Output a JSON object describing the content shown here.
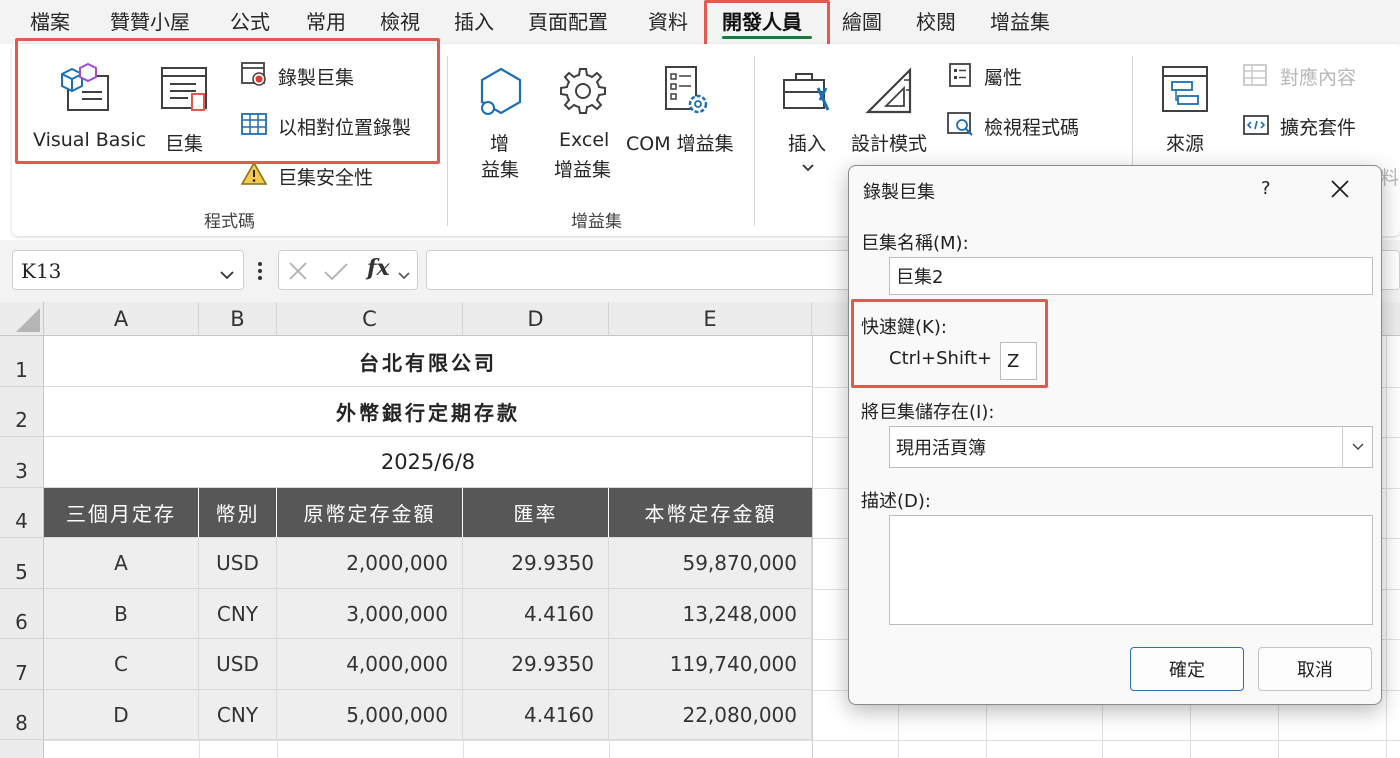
{
  "menu": {
    "tabs": [
      "檔案",
      "贊贊小屋",
      "公式",
      "常用",
      "檢視",
      "插入",
      "頁面配置",
      "資料",
      "開發人員",
      "繪圖",
      "校閱",
      "增益集"
    ],
    "active_tab": "開發人員"
  },
  "ribbon": {
    "code_group": {
      "label": "程式碼",
      "visual_basic": "Visual Basic",
      "macros": "巨集",
      "record_macro": "錄製巨集",
      "relative_ref": "以相對位置錄製",
      "macro_security": "巨集安全性"
    },
    "addins_group": {
      "label": "增益集",
      "addins_line1": "增",
      "addins_line2": "益集",
      "excel_addins_line1": "Excel",
      "excel_addins_line2": "增益集",
      "com_addins": "COM 增益集"
    },
    "controls_group": {
      "insert": "插入",
      "design_mode": "設計模式",
      "properties": "屬性",
      "view_code": "檢視程式碼"
    },
    "xml_group": {
      "source": "來源",
      "map_properties": "對應內容",
      "expansion_packs": "擴充套件",
      "refresh_data_partial": "料"
    }
  },
  "formula_bar": {
    "name_box": "K13",
    "fx": "fx"
  },
  "sheet": {
    "columns": [
      "A",
      "B",
      "C",
      "D",
      "E"
    ],
    "rows": [
      "1",
      "2",
      "3",
      "4",
      "5",
      "6",
      "7",
      "8"
    ],
    "title": "台北有限公司",
    "subtitle": "外幣銀行定期存款",
    "date": "2025/6/8",
    "headers": [
      "三個月定存",
      "幣別",
      "原幣定存金額",
      "匯率",
      "本幣定存金額"
    ],
    "data": [
      [
        "A",
        "USD",
        "2,000,000",
        "29.9350",
        "59,870,000"
      ],
      [
        "B",
        "CNY",
        "3,000,000",
        "4.4160",
        "13,248,000"
      ],
      [
        "C",
        "USD",
        "4,000,000",
        "29.9350",
        "119,740,000"
      ],
      [
        "D",
        "CNY",
        "5,000,000",
        "4.4160",
        "22,080,000"
      ]
    ]
  },
  "dialog": {
    "title": "錄製巨集",
    "help": "?",
    "macro_name_label": "巨集名稱(M):",
    "macro_name_value": "巨集2",
    "shortcut_label": "快速鍵(K):",
    "shortcut_prefix": "Ctrl+Shift+",
    "shortcut_key": "Z",
    "store_label": "將巨集儲存在(I):",
    "store_value": "現用活頁簿",
    "description_label": "描述(D):",
    "description_value": "",
    "ok": "確定",
    "cancel": "取消"
  },
  "colors": {
    "highlight": "#e05a4d",
    "header_fill": "#575757",
    "data_fill": "#eeeeee",
    "active_tab_underline": "#1a7a3c"
  }
}
